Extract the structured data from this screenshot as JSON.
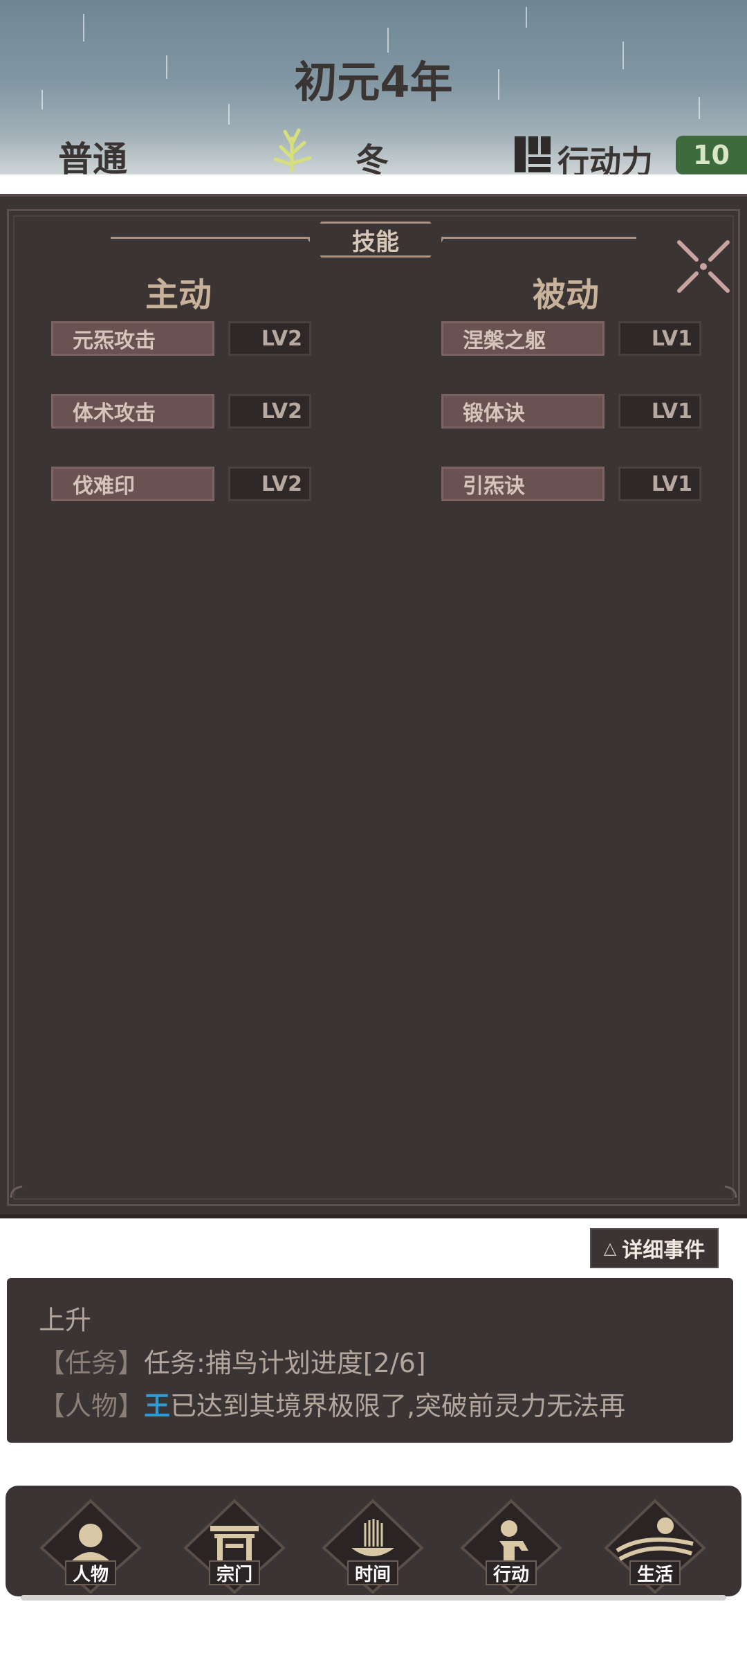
{
  "header": {
    "year": "初元4年",
    "mode": "普通",
    "season_icon": "reed-plant-icon",
    "season": "冬",
    "action_icon": "action-points-icon",
    "action_label": "行动力",
    "action_value": "10"
  },
  "skills": {
    "title": "技能",
    "active_heading": "主动",
    "passive_heading": "被动",
    "active": [
      {
        "name": "元炁攻击",
        "level": "LV2"
      },
      {
        "name": "体术攻击",
        "level": "LV2"
      },
      {
        "name": "伐难印",
        "level": "LV2"
      }
    ],
    "passive": [
      {
        "name": "涅槃之躯",
        "level": "LV1"
      },
      {
        "name": "锻体诀",
        "level": "LV1"
      },
      {
        "name": "引炁诀",
        "level": "LV1"
      }
    ]
  },
  "events": {
    "detail_button_icon": "triangle-up-icon",
    "detail_button": "详细事件",
    "line1": "上升",
    "line2_tag": "【任务】",
    "line2_text": "任务:捕鸟计划进度[2/6]",
    "line3_tag": "【人物】",
    "line3_name": "王",
    "line3_text": "已达到其境界极限了,突破前灵力无法再"
  },
  "nav": [
    {
      "label": "人物",
      "icon": "person-icon"
    },
    {
      "label": "宗门",
      "icon": "gate-icon"
    },
    {
      "label": "时间",
      "icon": "incense-icon"
    },
    {
      "label": "行动",
      "icon": "action-figure-icon"
    },
    {
      "label": "生活",
      "icon": "landscape-icon"
    }
  ],
  "colors": {
    "panel_bg": "#3b3434",
    "skill_button": "#6b5252",
    "action_badge": "#3e6b3e",
    "highlight_name": "#2f9bd5"
  }
}
